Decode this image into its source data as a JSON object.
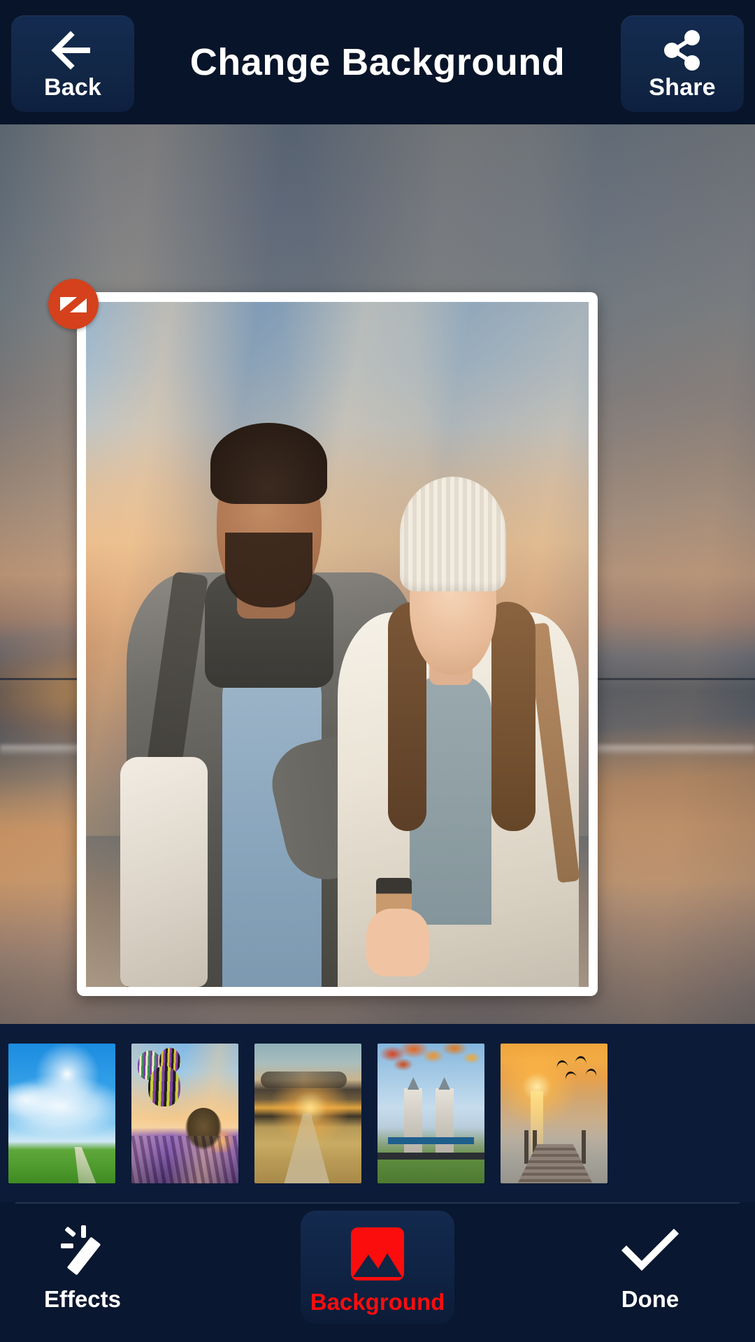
{
  "header": {
    "title": "Change Background",
    "back": {
      "label": "Back",
      "icon": "arrow-left-icon"
    },
    "share": {
      "label": "Share",
      "icon": "share-nodes-icon"
    },
    "background_color": "#081429",
    "button_color": "#132748",
    "text_color": "#ffffff"
  },
  "canvas": {
    "background_scene": "beach sunset with ocean and dusk clouds",
    "frame": {
      "photo_description": "smiling couple taking a selfie at sunset",
      "border_color": "#ffffff"
    },
    "resize_handle": {
      "icon": "resize-triangles-icon",
      "color": "#d4411c"
    }
  },
  "background_strip": {
    "thumbnails": [
      {
        "name": "blue-sky-meadow",
        "label": "Blue sky meadow"
      },
      {
        "name": "balloons-lavender",
        "label": "Hot air balloons over lavender"
      },
      {
        "name": "sunset-field-road",
        "label": "Sunset wheat field road"
      },
      {
        "name": "tower-bridge-autumn",
        "label": "Tower Bridge with autumn leaves"
      },
      {
        "name": "pier-sunset-birds",
        "label": "Pier sunset with birds"
      }
    ]
  },
  "bottom_nav": {
    "items": [
      {
        "label": "Effects",
        "icon": "magic-wand-icon",
        "selected": false
      },
      {
        "label": "Background",
        "icon": "image-mountain-icon",
        "selected": true
      },
      {
        "label": "Done",
        "icon": "checkmark-icon",
        "selected": false
      }
    ],
    "accent_color": "#fb0d0d",
    "background_color": "#091730"
  }
}
